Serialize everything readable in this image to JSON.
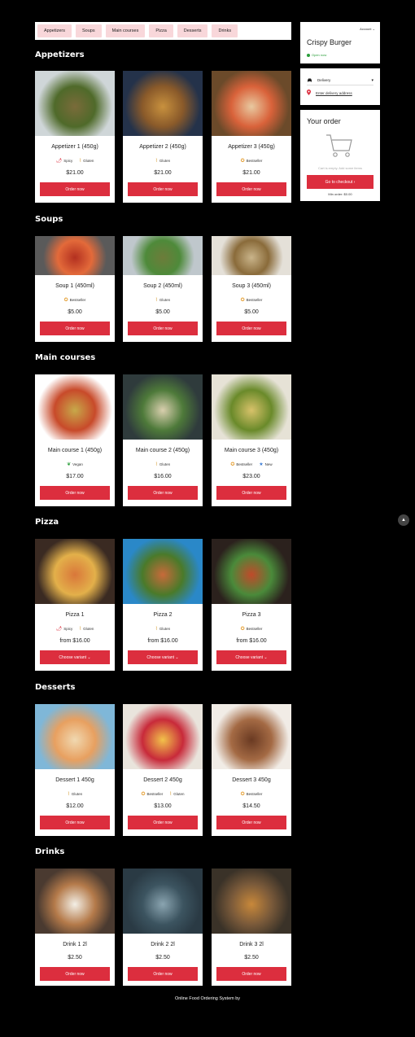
{
  "nav": {
    "categories": [
      "Appetizers",
      "Soups",
      "Main courses",
      "Pizza",
      "Desserts",
      "Drinks"
    ]
  },
  "sidebar": {
    "account_label": "Account",
    "restaurant_name": "Crispy Burger",
    "open_status": "Open now",
    "delivery_mode": "Delivery",
    "delivery_address_link": "Enter delivery address",
    "order_title": "Your order",
    "cart_empty_text": "Cart is empty. Add some items",
    "checkout_button": "Go to checkout ›",
    "min_order": "Min order: $0.00"
  },
  "sections": [
    {
      "title": "Appetizers",
      "items": [
        {
          "name": "Appetizer 1 (450g)",
          "badges": [
            "Spicy",
            "Gluten"
          ],
          "price": "$21.00",
          "button": "Order now"
        },
        {
          "name": "Appetizer 2 (450g)",
          "badges": [
            "Gluten"
          ],
          "price": "$21.00",
          "button": "Order now"
        },
        {
          "name": "Appetizer 3 (450g)",
          "badges": [
            "Bestseller"
          ],
          "price": "$21.00",
          "button": "Order now"
        }
      ]
    },
    {
      "title": "Soups",
      "items": [
        {
          "name": "Soup 1 (450ml)",
          "badges": [
            "Bestseller"
          ],
          "price": "$5.00",
          "button": "Order now"
        },
        {
          "name": "Soup 2 (450ml)",
          "badges": [
            "Gluten"
          ],
          "price": "$5.00",
          "button": "Order now"
        },
        {
          "name": "Soup 3 (450ml)",
          "badges": [
            "Bestseller"
          ],
          "price": "$5.00",
          "button": "Order now"
        }
      ]
    },
    {
      "title": "Main courses",
      "items": [
        {
          "name": "Main course 1 (450g)",
          "badges": [
            "Vegan"
          ],
          "price": "$17.00",
          "button": "Order now"
        },
        {
          "name": "Main course 2 (450g)",
          "badges": [
            "Gluten"
          ],
          "price": "$16.00",
          "button": "Order now"
        },
        {
          "name": "Main course 3 (450g)",
          "badges": [
            "Bestseller",
            "New"
          ],
          "price": "$23.00",
          "button": "Order now"
        }
      ]
    },
    {
      "title": "Pizza",
      "items": [
        {
          "name": "Pizza 1",
          "badges": [
            "Spicy",
            "Gluten"
          ],
          "price": "from $16.00",
          "button": "Choose variant ⌄"
        },
        {
          "name": "Pizza 2",
          "badges": [
            "Gluten"
          ],
          "price": "from $16.00",
          "button": "Choose variant ⌄"
        },
        {
          "name": "Pizza 3",
          "badges": [
            "Bestseller"
          ],
          "price": "from $16.00",
          "button": "Choose variant ⌄"
        }
      ]
    },
    {
      "title": "Desserts",
      "items": [
        {
          "name": "Dessert 1 450g",
          "badges": [
            "Gluten"
          ],
          "price": "$12.00",
          "button": "Order now"
        },
        {
          "name": "Dessert 2 450g",
          "badges": [
            "Bestseller",
            "Gluten"
          ],
          "price": "$13.00",
          "button": "Order now"
        },
        {
          "name": "Dessert 3 450g",
          "badges": [
            "Bestseller"
          ],
          "price": "$14.50",
          "button": "Order now"
        }
      ]
    },
    {
      "title": "Drinks",
      "items": [
        {
          "name": "Drink 1 2l",
          "badges": [],
          "price": "$2.50",
          "button": "Order now"
        },
        {
          "name": "Drink 2 2l",
          "badges": [],
          "price": "$2.50",
          "button": "Order now"
        },
        {
          "name": "Drink 3 2l",
          "badges": [],
          "price": "$2.50",
          "button": "Order now"
        }
      ]
    }
  ],
  "footer": "Online Food Ordering System by",
  "colors": {
    "accent": "#dc2e3e",
    "chip_bg": "#f8d7da",
    "background": "#000000",
    "open_green": "#2a9d3a"
  }
}
